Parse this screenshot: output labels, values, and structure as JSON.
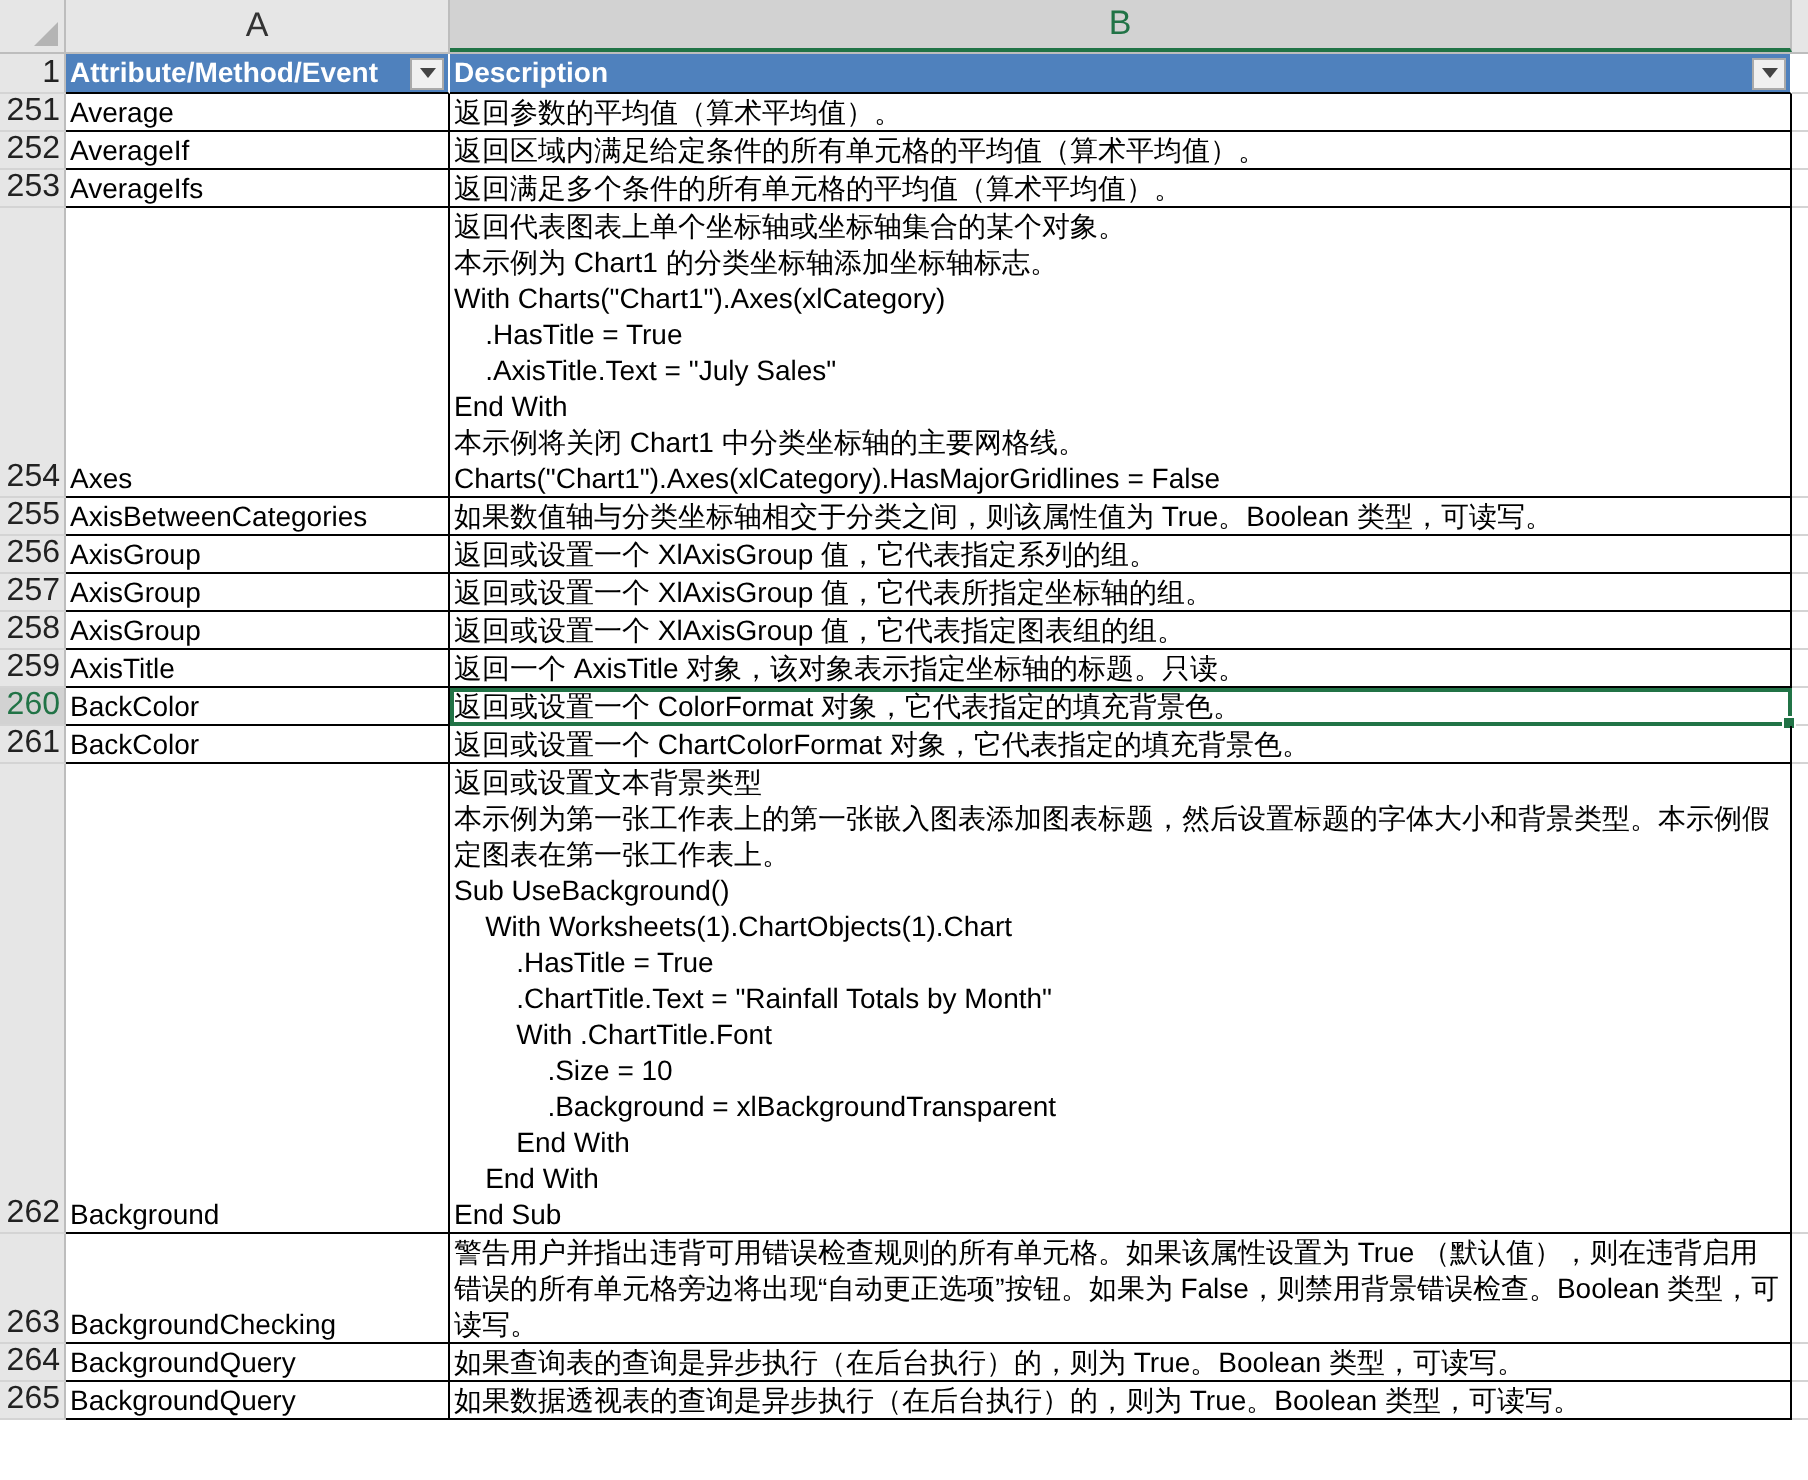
{
  "column_headers": [
    {
      "label": "A",
      "selected": false
    },
    {
      "label": "B",
      "selected": true
    }
  ],
  "header_row": {
    "number": "1",
    "cells": [
      "Attribute/Method/Event",
      "Description"
    ]
  },
  "rows": [
    {
      "number": "251",
      "name": "Average",
      "lines": [
        "返回参数的平均值（算术平均值）。"
      ],
      "selected": false
    },
    {
      "number": "252",
      "name": "AverageIf",
      "lines": [
        "返回区域内满足给定条件的所有单元格的平均值（算术平均值）。"
      ],
      "selected": false
    },
    {
      "number": "253",
      "name": "AverageIfs",
      "lines": [
        "返回满足多个条件的所有单元格的平均值（算术平均值）。"
      ],
      "selected": false
    },
    {
      "number": "254",
      "name": "Axes",
      "lines": [
        "返回代表图表上单个坐标轴或坐标轴集合的某个对象。",
        "本示例为 Chart1 的分类坐标轴添加坐标轴标志。",
        "With Charts(\"Chart1\").Axes(xlCategory)",
        "    .HasTitle = True",
        "    .AxisTitle.Text = \"July Sales\"",
        "End With",
        "本示例将关闭 Chart1 中分类坐标轴的主要网格线。",
        "Charts(\"Chart1\").Axes(xlCategory).HasMajorGridlines = False"
      ],
      "selected": false
    },
    {
      "number": "255",
      "name": "AxisBetweenCategories",
      "lines": [
        "如果数值轴与分类坐标轴相交于分类之间，则该属性值为 True。Boolean 类型，可读写。"
      ],
      "selected": false
    },
    {
      "number": "256",
      "name": "AxisGroup",
      "lines": [
        "返回或设置一个 XlAxisGroup 值，它代表指定系列的组。"
      ],
      "selected": false
    },
    {
      "number": "257",
      "name": "AxisGroup",
      "lines": [
        "返回或设置一个 XlAxisGroup 值，它代表所指定坐标轴的组。"
      ],
      "selected": false
    },
    {
      "number": "258",
      "name": "AxisGroup",
      "lines": [
        "返回或设置一个 XlAxisGroup 值，它代表指定图表组的组。"
      ],
      "selected": false
    },
    {
      "number": "259",
      "name": "AxisTitle",
      "lines": [
        "返回一个 AxisTitle 对象，该对象表示指定坐标轴的标题。只读。"
      ],
      "selected": false
    },
    {
      "number": "260",
      "name": "BackColor",
      "lines": [
        "返回或设置一个 ColorFormat 对象，它代表指定的填充背景色。"
      ],
      "selected": true
    },
    {
      "number": "261",
      "name": "BackColor",
      "lines": [
        "返回或设置一个 ChartColorFormat 对象，它代表指定的填充背景色。"
      ],
      "selected": false
    },
    {
      "number": "262",
      "name": "Background",
      "lines": [
        "返回或设置文本背景类型",
        "本示例为第一张工作表上的第一张嵌入图表添加图表标题，然后设置标题的字体大小和背景类型。本示例假定图表在第一张工作表上。",
        "Sub UseBackground()",
        "    With Worksheets(1).ChartObjects(1).Chart",
        "        .HasTitle = True",
        "        .ChartTitle.Text = \"Rainfall Totals by Month\"",
        "        With .ChartTitle.Font",
        "            .Size = 10",
        "            .Background = xlBackgroundTransparent",
        "        End With",
        "    End With",
        "End Sub"
      ],
      "selected": false
    },
    {
      "number": "263",
      "name": "BackgroundChecking",
      "lines": [
        "警告用户并指出违背可用错误检查规则的所有单元格。如果该属性设置为 True （默认值），则在违背启用错误的所有单元格旁边将出现“自动更正选项”按钮。如果为 False，则禁用背景错误检查。Boolean 类型，可读写。"
      ],
      "selected": false
    },
    {
      "number": "264",
      "name": "BackgroundQuery",
      "lines": [
        "如果查询表的查询是异步执行（在后台执行）的，则为 True。Boolean 类型，可读写。"
      ],
      "selected": false
    },
    {
      "number": "265",
      "name": "BackgroundQuery",
      "lines": [
        "如果数据透视表的查询是异步执行（在后台执行）的，则为 True。Boolean 类型，可读写。"
      ],
      "selected": false
    }
  ]
}
